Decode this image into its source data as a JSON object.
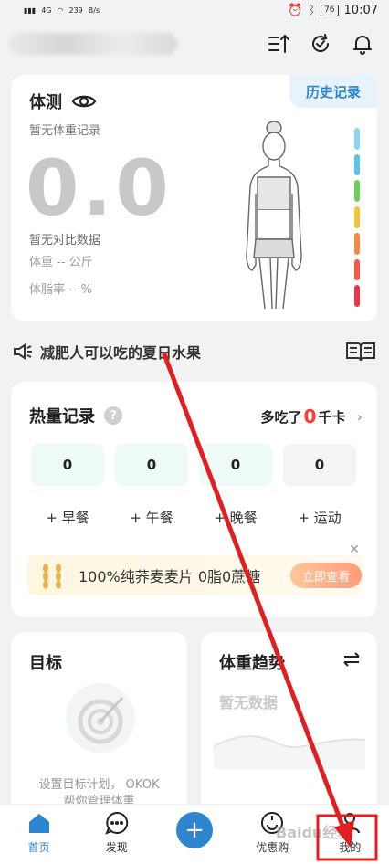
{
  "status_bar": {
    "signal_left": "4G",
    "speed": "239",
    "speed_unit": "B/s",
    "battery": "76",
    "time": "10:07"
  },
  "header": {
    "icons": [
      "sort-icon",
      "sync-icon",
      "bell-icon"
    ]
  },
  "weight_card": {
    "title": "体测",
    "history_label": "历史记录",
    "no_record": "暂无体重记录",
    "big_value": "0.0",
    "no_compare": "暂无对比数据",
    "weight_label": "体重",
    "weight_value": "-- 公斤",
    "bodyfat_label": "体脂率",
    "bodyfat_value": "-- %",
    "scale_colors": [
      "#8fd3f4",
      "#5ec3e8",
      "#6fcf5a",
      "#f2c33b",
      "#f28a45",
      "#ef5a4a",
      "#e8364a"
    ]
  },
  "news": {
    "text": "减肥人可以吃的夏日水果"
  },
  "calorie_card": {
    "title": "热量记录",
    "help": "?",
    "over_prefix": "多吃了",
    "over_value": "0",
    "over_unit": "千卡",
    "meals": [
      {
        "value": "0",
        "label": "早餐",
        "bg": "#eefaf7"
      },
      {
        "value": "0",
        "label": "午餐",
        "bg": "#eefaf7"
      },
      {
        "value": "0",
        "label": "晚餐",
        "bg": "#eefaf7"
      },
      {
        "value": "0",
        "label": "运动",
        "bg": "#f3f4f6"
      }
    ],
    "promo_text": "100%纯荞麦麦片 0脂0蔗糖",
    "promo_button": "立即查看"
  },
  "goal_card": {
    "title": "目标",
    "line1": "设置目标计划， OKOK",
    "line2": "帮你管理体重"
  },
  "trend_card": {
    "title": "体重趋势",
    "empty": "暂无数据"
  },
  "tabbar": {
    "tabs": [
      {
        "label": "首页",
        "active": true
      },
      {
        "label": "发现",
        "active": false
      },
      {
        "label": "+",
        "active": false
      },
      {
        "label": "优惠购",
        "active": false
      },
      {
        "label": "我的",
        "active": false
      }
    ]
  },
  "watermark": "Baidu经验",
  "annotation": {
    "arrow_color": "#e02020",
    "box_color": "#e02020"
  }
}
